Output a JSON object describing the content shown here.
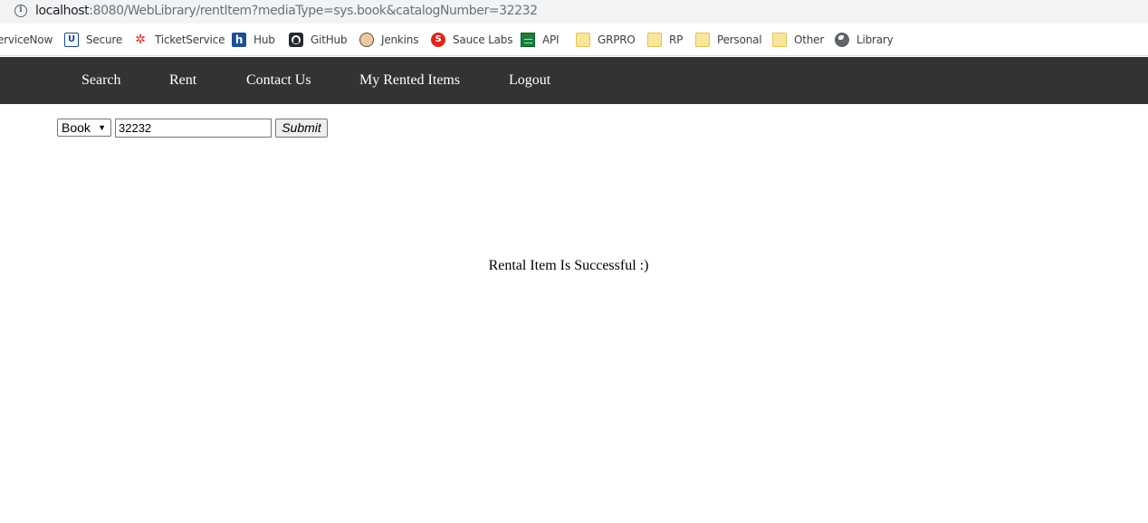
{
  "browser": {
    "url_host": "localhost",
    "url_path": ":8080/WebLibrary/rentItem?mediaType=sys.book&catalogNumber=32232",
    "bookmarks": [
      {
        "label": "erviceNow",
        "icon": "none"
      },
      {
        "label": "Secure",
        "icon": "u-square-icon"
      },
      {
        "label": "TicketService",
        "icon": "ticket-icon"
      },
      {
        "label": "Hub",
        "icon": "hub-icon"
      },
      {
        "label": "GitHub",
        "icon": "github-icon"
      },
      {
        "label": "Jenkins",
        "icon": "jenkins-icon"
      },
      {
        "label": "Sauce Labs",
        "icon": "sauce-labs-icon"
      },
      {
        "label": "API",
        "icon": "api-icon"
      },
      {
        "label": "GRPRO",
        "icon": "folder-icon"
      },
      {
        "label": "RP",
        "icon": "folder-icon"
      },
      {
        "label": "Personal",
        "icon": "folder-icon"
      },
      {
        "label": "Other",
        "icon": "folder-icon"
      },
      {
        "label": "Library",
        "icon": "globe-icon"
      }
    ]
  },
  "nav": {
    "items": [
      "Search",
      "Rent",
      "Contact Us",
      "My Rented Items",
      "Logout"
    ]
  },
  "form": {
    "media_type": "Book",
    "catalog_number": "32232",
    "submit_label": "Submit"
  },
  "message": "Rental Item Is Successful :)",
  "colors": {
    "nav_background": "#333333",
    "nav_text": "#ffffff"
  }
}
